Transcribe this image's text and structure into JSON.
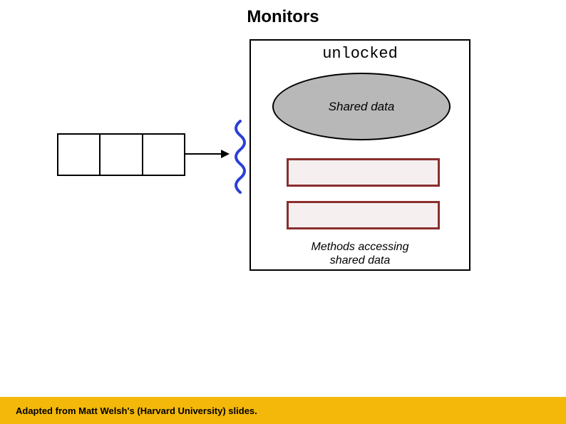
{
  "title": "Monitors",
  "lock_state": "unlocked",
  "shared_label": "Shared data",
  "methods_label_line1": "Methods accessing",
  "methods_label_line2": "shared data",
  "credit": "Adapted from Matt Welsh's (Harvard University) slides.",
  "colors": {
    "accent_bar": "#f3b80a",
    "method_border": "#8b2e2e",
    "shared_fill": "#b8b8b8",
    "squiggle": "#2a3fd6"
  },
  "queue_cells": 3,
  "method_boxes": 2
}
